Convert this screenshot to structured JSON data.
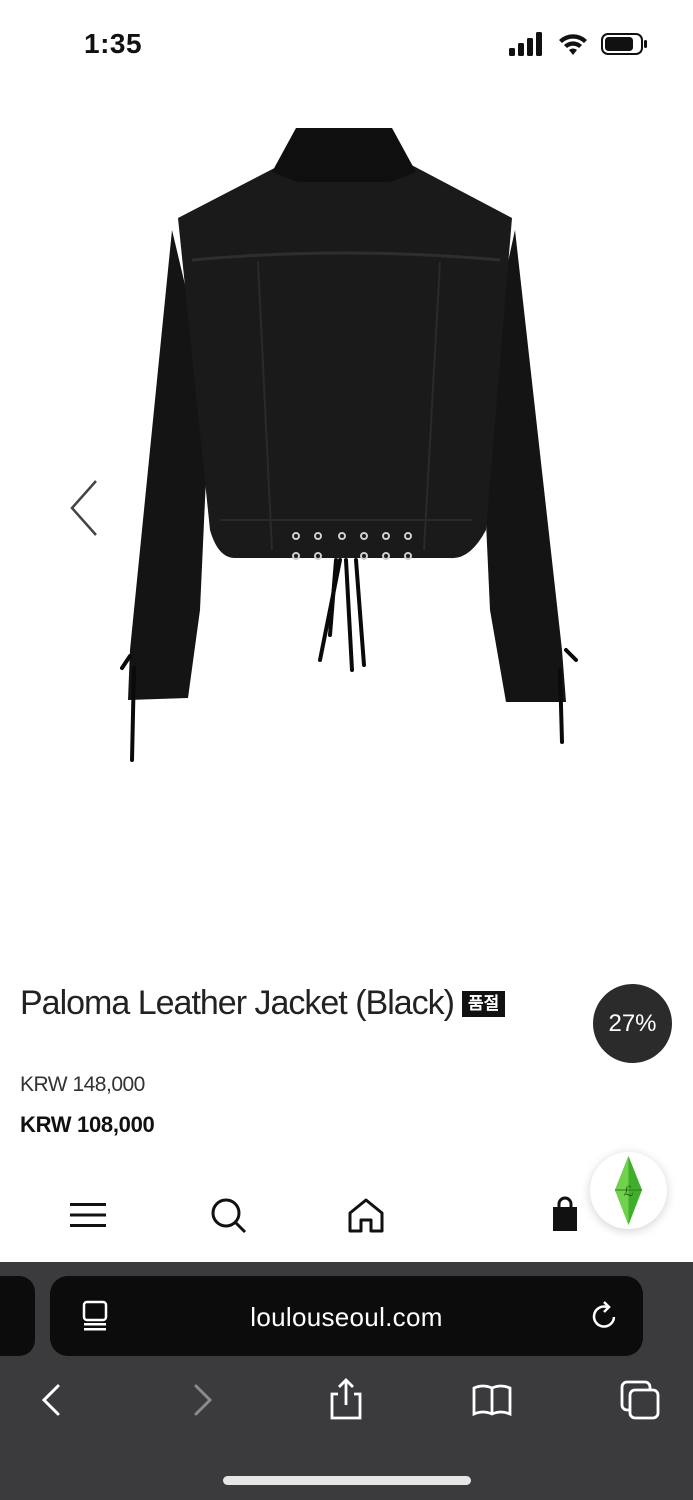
{
  "status_bar": {
    "time": "1:35",
    "icons": [
      "signal-icon",
      "wifi-icon",
      "battery-icon"
    ]
  },
  "product": {
    "image_alt": "black leather jacket back view",
    "title": "Paloma Leather Jacket (Black)",
    "soldout_badge": "품절",
    "discount": "27%",
    "original_price": "KRW 148,000",
    "sale_price": "KRW 108,000"
  },
  "site_nav": {
    "items": [
      "menu-icon",
      "search-icon",
      "home-icon",
      "shopping-bag-icon"
    ]
  },
  "browser": {
    "url": "loulouseoul.com",
    "toolbar": [
      "back-icon",
      "forward-icon",
      "share-icon",
      "bookmarks-icon",
      "tabs-icon"
    ]
  },
  "colors": {
    "badge_bg": "#2b2b2b",
    "browser_bg": "#3b3b3d",
    "url_bar_bg": "#0c0c0c",
    "logo_green": "#3fae2a"
  }
}
